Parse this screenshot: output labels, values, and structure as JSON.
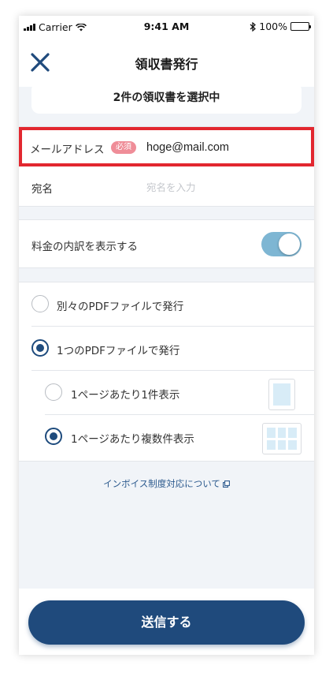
{
  "status_bar": {
    "carrier": "Carrier",
    "time": "9:41 AM",
    "battery": "100%"
  },
  "header": {
    "title": "領収書発行"
  },
  "selection": {
    "text": "2件の領収書を選択中"
  },
  "form": {
    "email_label": "メールアドレス",
    "required_badge": "必須",
    "email_value": "hoge@mail.com",
    "name_label": "宛名",
    "name_placeholder": "宛名を入力"
  },
  "breakdown": {
    "label": "料金の内訳を表示する",
    "enabled": true
  },
  "options": {
    "separate_pdf": "別々のPDFファイルで発行",
    "single_pdf": "1つのPDFファイルで発行",
    "one_per_page": "1ページあたり1件表示",
    "multi_per_page": "1ページあたり複数件表示",
    "selected": [
      "single_pdf",
      "multi_per_page"
    ]
  },
  "invoice_link": "インボイス制度対応について",
  "submit": {
    "label": "送信する"
  },
  "colors": {
    "primary": "#1f4a7c",
    "toggle_on": "#7eb6d3",
    "required_badge": "#ef8d98",
    "highlight_border": "#e2272f"
  }
}
